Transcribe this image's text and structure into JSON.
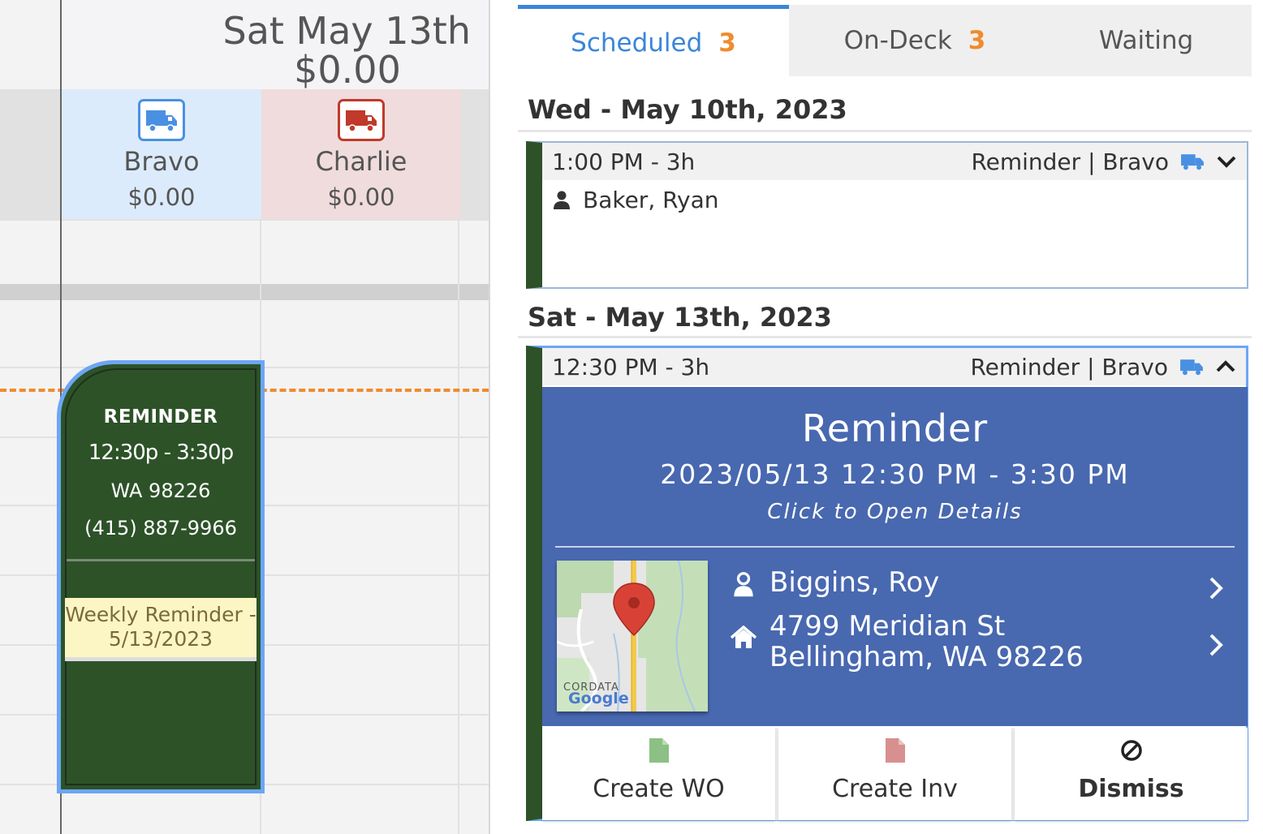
{
  "calendar": {
    "day_title": "Sat May 13th",
    "day_total": "$0.00",
    "trucks": [
      {
        "name": "Bravo",
        "amount": "$0.00",
        "color": "#4a90e2"
      },
      {
        "name": "Charlie",
        "amount": "$0.00",
        "color": "#c0392b"
      }
    ],
    "event": {
      "type": "REMINDER",
      "time": "12:30p - 3:30p",
      "zip": "WA 98226",
      "phone": "(415) 887-9966",
      "note": "Weekly Reminder - 5/13/2023"
    }
  },
  "tabs": [
    {
      "label": "Scheduled",
      "count": "3",
      "active": true
    },
    {
      "label": "On-Deck",
      "count": "3",
      "active": false
    },
    {
      "label": "Waiting",
      "count": "",
      "active": false
    }
  ],
  "groups": [
    {
      "date": "Wed - May 10th, 2023",
      "card": {
        "time": "1:00 PM - 3h",
        "meta": "Reminder | Bravo",
        "person": "Baker, Ryan"
      }
    },
    {
      "date": "Sat - May 13th, 2023",
      "card": {
        "time": "12:30 PM - 3h",
        "meta": "Reminder | Bravo",
        "title": "Reminder",
        "range": "2023/05/13 12:30 PM - 3:30 PM",
        "click_hint": "Click to Open Details",
        "person": "Biggins, Roy",
        "address_line1": "4799 Meridian St",
        "address_line2": "Bellingham, WA 98226",
        "map_label": "CORDATA",
        "map_brand": "Google",
        "actions": [
          "Create WO",
          "Create Inv",
          "Dismiss"
        ]
      }
    }
  ],
  "colors": {
    "accent": "#3a86d8",
    "count": "#f08b2e",
    "event_green": "#2d5228",
    "detail_blue": "#4868b0"
  }
}
